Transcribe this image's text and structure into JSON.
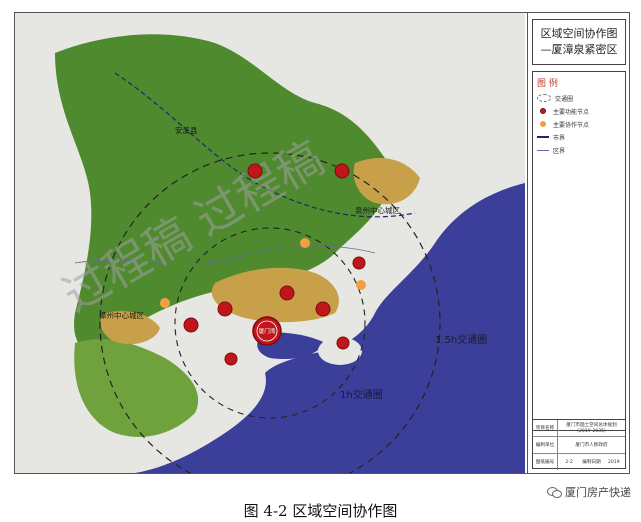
{
  "map": {
    "title_line1": "区域空间协作图",
    "title_line2": "—厦漳泉紧密区",
    "legend_title": "图 例",
    "legend": [
      {
        "label": "交通圈",
        "symbol": "dashed-circle"
      },
      {
        "label": "主要功能节点",
        "symbol": "red-dot"
      },
      {
        "label": "主要协作节点",
        "symbol": "orange-dot"
      },
      {
        "label": "市界",
        "symbol": "dashed-line"
      },
      {
        "label": "区界",
        "symbol": "solid-line"
      }
    ],
    "place_labels": {
      "anxi": "安溪县",
      "quanzhou": "泉州中心城区",
      "zhangzhou": "漳州中心城区",
      "ring_outer": "1.5h交通圈",
      "ring_inner": "1h交通圈"
    },
    "nodes": [
      {
        "label": "厦门湾",
        "type": "main",
        "size": "large"
      },
      {
        "label": "",
        "type": "main"
      },
      {
        "label": "",
        "type": "main"
      },
      {
        "label": "",
        "type": "main"
      },
      {
        "label": "",
        "type": "main"
      },
      {
        "label": "",
        "type": "main"
      },
      {
        "label": "",
        "type": "main"
      },
      {
        "label": "",
        "type": "main"
      },
      {
        "label": "",
        "type": "main"
      },
      {
        "label": "",
        "type": "main"
      },
      {
        "label": "",
        "type": "main"
      },
      {
        "label": "",
        "type": "main"
      },
      {
        "label": "",
        "type": "main"
      }
    ],
    "watermark": "过程稿 过程稿",
    "info": {
      "row1_key": "项目名称",
      "row1_val": "厦门市国土空间总体规划（2019-2035）",
      "row2_key": "编制单位",
      "row2_val": "厦门市人民政府",
      "row3_key": "图纸编号",
      "row3_num": "2-2",
      "row3_mid": "编制日期",
      "row3_year": "2019"
    },
    "colors": {
      "forest": "#4f8a2f",
      "sea": "#3b3f9a",
      "urban": "#c8a04a",
      "node": "#c0161b"
    }
  },
  "caption": "图 4-2 区域空间协作图",
  "wechat_account": "厦门房产快递"
}
